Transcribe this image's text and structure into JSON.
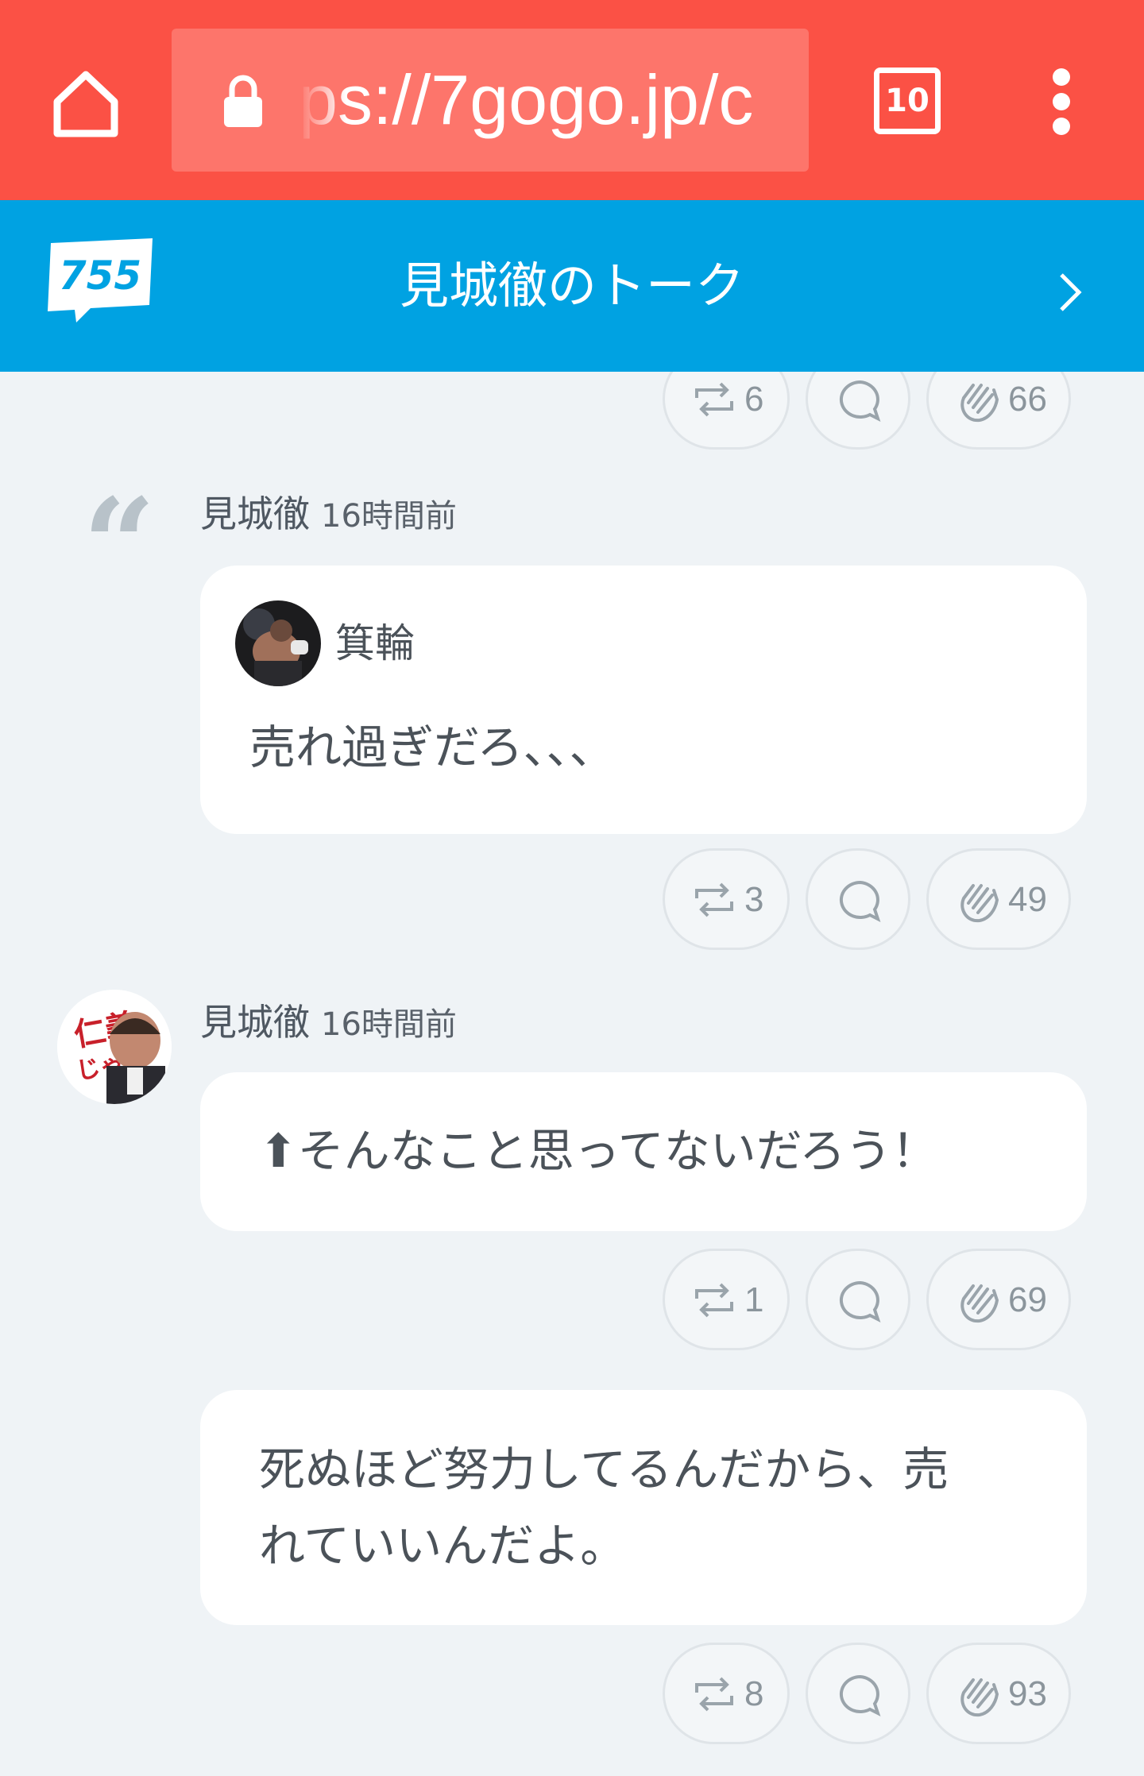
{
  "browser": {
    "url": "ps://7gogo.jp/c",
    "tab_count": "10",
    "theme_color": "#fb5145"
  },
  "header": {
    "logo_text": "755",
    "title": "見城徹のトーク",
    "color": "#00a2e2"
  },
  "posts": [
    {
      "actions": {
        "retweet": "6",
        "clap": "66"
      }
    },
    {
      "author": "見城徹",
      "time": "16時間前",
      "quote_author": "箕輪",
      "quote_text": "売れ過ぎだろ、、、",
      "actions": {
        "retweet": "3",
        "clap": "49"
      }
    },
    {
      "author": "見城徹",
      "time": "16時間前",
      "text": "⬆︎そんなこと思ってないだろう！",
      "actions": {
        "retweet": "1",
        "clap": "69"
      }
    },
    {
      "text_line1": "死ぬほど努力してるんだから、売",
      "text_line2": "れていいんだよ。",
      "actions": {
        "retweet": "8",
        "clap": "93"
      }
    }
  ]
}
